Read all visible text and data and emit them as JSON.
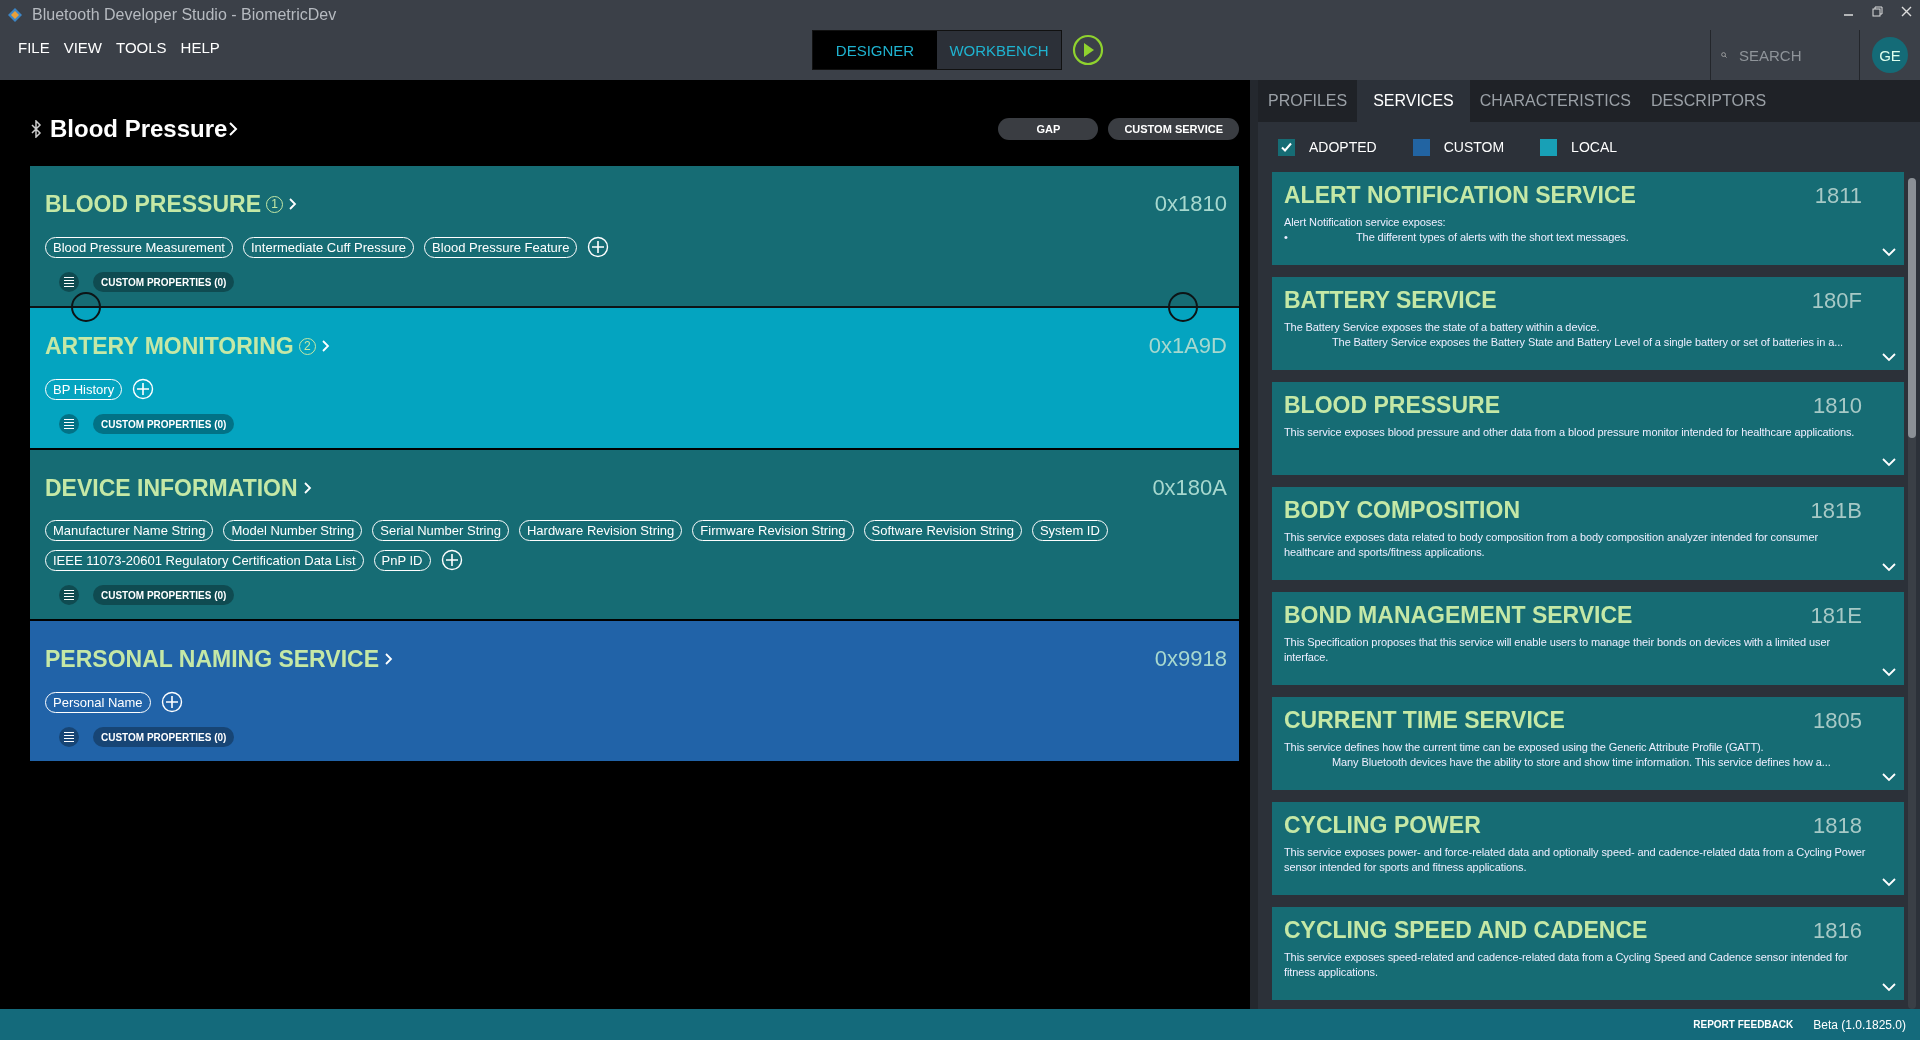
{
  "window": {
    "title": "Bluetooth Developer Studio - BiometricDev"
  },
  "menu": [
    "FILE",
    "VIEW",
    "TOOLS",
    "HELP"
  ],
  "modes": [
    {
      "label": "DESIGNER",
      "selected": true
    },
    {
      "label": "WORKBENCH",
      "selected": false
    }
  ],
  "search": {
    "placeholder": "SEARCH"
  },
  "user": {
    "initials": "GE"
  },
  "profile": {
    "title": "Blood Pressure",
    "actions": [
      "GAP",
      "CUSTOM SERVICE"
    ]
  },
  "services": [
    {
      "color": "#166c74",
      "title": "BLOOD PRESSURE",
      "count": "1",
      "uuid": "0x1810",
      "characteristics": [
        "Blood Pressure Measurement",
        "Intermediate Cuff Pressure",
        "Blood Pressure Feature"
      ],
      "custom_properties": "CUSTOM PROPERTIES (0)",
      "linked_to_next": true
    },
    {
      "color": "#04a4c0",
      "title": "ARTERY MONITORING",
      "count": "2",
      "uuid": "0x1A9D",
      "characteristics": [
        "BP History"
      ],
      "custom_properties": "CUSTOM PROPERTIES (0)",
      "linked_to_next": false
    },
    {
      "color": "#166c74",
      "title": "DEVICE INFORMATION",
      "uuid": "0x180A",
      "characteristics": [
        "Manufacturer Name String",
        "Model Number String",
        "Serial Number String",
        "Hardware Revision String",
        "Firmware Revision String",
        "Software Revision String",
        "System ID",
        "IEEE 11073-20601 Regulatory Certification Data List",
        "PnP ID"
      ],
      "custom_properties": "CUSTOM PROPERTIES (0)",
      "linked_to_next": false
    },
    {
      "color": "#2163a8",
      "title": "PERSONAL NAMING SERVICE",
      "uuid": "0x9918",
      "characteristics": [
        "Personal Name"
      ],
      "custom_properties": "CUSTOM PROPERTIES (0)",
      "linked_to_next": false
    }
  ],
  "library": {
    "tabs": [
      {
        "label": "PROFILES",
        "selected": false
      },
      {
        "label": "SERVICES",
        "selected": true
      },
      {
        "label": "CHARACTERISTICS",
        "selected": false
      },
      {
        "label": "DESCRIPTORS",
        "selected": false
      }
    ],
    "filters": [
      {
        "label": "ADOPTED",
        "checked": true,
        "color": "#166c74"
      },
      {
        "label": "CUSTOM",
        "checked": false,
        "color": "#2264a2"
      },
      {
        "label": "LOCAL",
        "checked": false,
        "color": "#18a0b6"
      }
    ],
    "items": [
      {
        "title": "ALERT NOTIFICATION SERVICE",
        "uuid": "1811",
        "lines": [
          {
            "kind": "plain",
            "text": "Alert Notification service exposes:"
          },
          {
            "kind": "bullet",
            "marker": "•",
            "text": "The different types of alerts with the short text messages."
          }
        ]
      },
      {
        "title": "BATTERY SERVICE",
        "uuid": "180F",
        "lines": [
          {
            "kind": "plain",
            "text": "The Battery Service exposes the state of a battery within a device."
          },
          {
            "kind": "indent",
            "text": "The Battery Service exposes the Battery State and Battery Level of a single battery or set of batteries in a..."
          }
        ]
      },
      {
        "title": "BLOOD PRESSURE",
        "uuid": "1810",
        "lines": [
          {
            "kind": "plain",
            "text": "This service exposes blood pressure and other data from a blood pressure monitor intended for healthcare applications."
          }
        ]
      },
      {
        "title": "BODY COMPOSITION",
        "uuid": "181B",
        "lines": [
          {
            "kind": "plain",
            "text": "This service exposes data related to body composition from a body composition analyzer intended for consumer healthcare and sports/fitness applications."
          }
        ]
      },
      {
        "title": "BOND MANAGEMENT SERVICE",
        "uuid": "181E",
        "lines": [
          {
            "kind": "plain",
            "text": "This Specification proposes that this service will enable users to manage their bonds on devices with a limited user interface."
          }
        ]
      },
      {
        "title": "CURRENT TIME SERVICE",
        "uuid": "1805",
        "lines": [
          {
            "kind": "plain",
            "text": "This service defines how the current time can be exposed using the Generic Attribute Profile (GATT)."
          },
          {
            "kind": "indent",
            "text": "Many Bluetooth devices have the ability to store and show time information. This service defines how a..."
          }
        ]
      },
      {
        "title": "CYCLING POWER",
        "uuid": "1818",
        "lines": [
          {
            "kind": "plain",
            "text": "This service exposes power- and force-related data and optionally speed- and cadence-related data from a Cycling Power sensor intended for sports and fitness applications."
          }
        ]
      },
      {
        "title": "CYCLING SPEED AND CADENCE",
        "uuid": "1816",
        "lines": [
          {
            "kind": "plain",
            "text": "This service exposes speed-related and cadence-related data from a Cycling Speed and Cadence sensor intended for fitness applications."
          }
        ]
      }
    ]
  },
  "status_bar": {
    "link": "REPORT FEEDBACK",
    "version": "Beta (1.0.1825.0)"
  }
}
